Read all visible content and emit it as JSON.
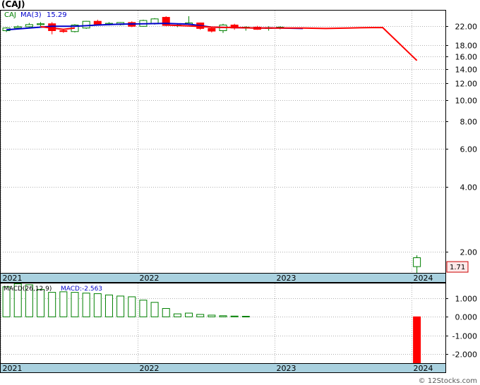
{
  "title": "(CAJ)",
  "footer": "© 12Stocks.com",
  "colors": {
    "up": "#008000",
    "down": "#ff0000",
    "ma": "#0000cc",
    "axis_band": "#a9d1df",
    "grid": "#b0b0b0",
    "macd_label": "#0000cc"
  },
  "chart_data": [
    {
      "type": "candlestick",
      "legend": {
        "symbol": "CAJ",
        "ma_label": "MA(3)",
        "ma_value": "15.29"
      },
      "last_price_label": "1.71",
      "y_scale": "log",
      "ylim": [
        1.6,
        26
      ],
      "y_ticks": [
        2.0,
        4.0,
        6.0,
        8.0,
        10.0,
        12.0,
        14.0,
        16.0,
        18.0,
        22.0
      ],
      "y_tick_labels": [
        "2.00",
        "4.00",
        "6.00",
        "8.00",
        "10.00",
        "12.00",
        "14.00",
        "16.00",
        "18.00",
        "22.00"
      ],
      "x_labels": [
        "2021",
        "2022",
        "2023",
        "2024"
      ],
      "x_label_months": [
        0,
        12,
        24,
        36
      ],
      "xlim": [
        -0.5,
        38.5
      ],
      "candles": [
        {
          "m": 0,
          "o": 21.0,
          "h": 21.8,
          "l": 20.7,
          "c": 21.6
        },
        {
          "m": 1,
          "o": 21.6,
          "h": 22.2,
          "l": 21.3,
          "c": 21.9
        },
        {
          "m": 2,
          "o": 21.9,
          "h": 22.8,
          "l": 21.6,
          "c": 22.4
        },
        {
          "m": 3,
          "o": 22.4,
          "h": 23.0,
          "l": 22.0,
          "c": 22.6
        },
        {
          "m": 4,
          "o": 22.6,
          "h": 23.0,
          "l": 20.2,
          "c": 21.0
        },
        {
          "m": 5,
          "o": 21.0,
          "h": 21.3,
          "l": 20.5,
          "c": 20.8
        },
        {
          "m": 6,
          "o": 20.8,
          "h": 22.5,
          "l": 20.6,
          "c": 22.3
        },
        {
          "m": 7,
          "o": 21.6,
          "h": 23.3,
          "l": 21.4,
          "c": 23.2
        },
        {
          "m": 8,
          "o": 23.2,
          "h": 23.6,
          "l": 22.3,
          "c": 22.5
        },
        {
          "m": 9,
          "o": 22.5,
          "h": 23.0,
          "l": 22.2,
          "c": 22.7
        },
        {
          "m": 10,
          "o": 22.4,
          "h": 23.0,
          "l": 22.2,
          "c": 22.9
        },
        {
          "m": 11,
          "o": 22.9,
          "h": 23.2,
          "l": 21.8,
          "c": 22.0
        },
        {
          "m": 12,
          "o": 22.0,
          "h": 23.6,
          "l": 21.9,
          "c": 23.4
        },
        {
          "m": 13,
          "o": 22.6,
          "h": 24.0,
          "l": 22.4,
          "c": 23.8
        },
        {
          "m": 14,
          "o": 24.2,
          "h": 24.5,
          "l": 22.0,
          "c": 22.2
        },
        {
          "m": 15,
          "o": 22.2,
          "h": 22.6,
          "l": 21.8,
          "c": 22.3
        },
        {
          "m": 16,
          "o": 22.5,
          "h": 24.5,
          "l": 22.3,
          "c": 22.8
        },
        {
          "m": 17,
          "o": 22.8,
          "h": 22.9,
          "l": 21.2,
          "c": 21.5
        },
        {
          "m": 18,
          "o": 21.5,
          "h": 21.9,
          "l": 20.6,
          "c": 20.9
        },
        {
          "m": 19,
          "o": 21.0,
          "h": 22.6,
          "l": 20.5,
          "c": 22.3
        },
        {
          "m": 20,
          "o": 22.3,
          "h": 22.6,
          "l": 21.2,
          "c": 21.6
        },
        {
          "m": 21,
          "o": 21.6,
          "h": 22.0,
          "l": 21.0,
          "c": 21.8
        },
        {
          "m": 22,
          "o": 21.8,
          "h": 22.1,
          "l": 21.2,
          "c": 21.3
        },
        {
          "m": 23,
          "o": 21.5,
          "h": 22.0,
          "l": 21.0,
          "c": 21.7
        },
        {
          "m": 24,
          "o": 21.7,
          "h": 22.0,
          "l": 21.3,
          "c": 21.8
        },
        {
          "m": 36,
          "o": 1.71,
          "h": 1.93,
          "l": 1.6,
          "c": 1.88
        }
      ],
      "ma_blue": [
        {
          "m": 0,
          "v": 21.2
        },
        {
          "m": 2,
          "v": 21.6
        },
        {
          "m": 4,
          "v": 22.0
        },
        {
          "m": 6,
          "v": 22.0
        },
        {
          "m": 8,
          "v": 22.3
        },
        {
          "m": 10,
          "v": 22.5
        },
        {
          "m": 12,
          "v": 22.6
        },
        {
          "m": 14,
          "v": 22.7
        },
        {
          "m": 16,
          "v": 22.5
        },
        {
          "m": 18,
          "v": 21.8
        },
        {
          "m": 20,
          "v": 21.7
        },
        {
          "m": 22,
          "v": 21.6
        },
        {
          "m": 24,
          "v": 21.6
        },
        {
          "m": 26,
          "v": 21.5
        }
      ],
      "ma_red": [
        {
          "m": 3,
          "v": 21.9
        },
        {
          "m": 5,
          "v": 21.3
        },
        {
          "m": 6,
          "v": 21.6
        }
      ],
      "ma_red_tail": [
        {
          "m": 14,
          "v": 22.3
        },
        {
          "m": 16,
          "v": 22.1
        },
        {
          "m": 18,
          "v": 21.8
        },
        {
          "m": 20,
          "v": 21.7
        },
        {
          "m": 22,
          "v": 21.6
        },
        {
          "m": 24,
          "v": 21.6
        },
        {
          "m": 26,
          "v": 21.6
        },
        {
          "m": 28,
          "v": 21.5
        },
        {
          "m": 30,
          "v": 21.6
        },
        {
          "m": 32,
          "v": 21.7
        },
        {
          "m": 33,
          "v": 21.7
        },
        {
          "m": 36,
          "v": 15.29
        }
      ]
    },
    {
      "type": "bar",
      "legend": {
        "label": "MACD(26,12,9)",
        "value_label": "MACD:-2.563"
      },
      "ylim": [
        -2.5,
        1.8
      ],
      "y_ticks": [
        1.0,
        0.0,
        -1.0,
        -2.0
      ],
      "y_tick_labels": [
        "1.000",
        "0.000",
        "-1.000",
        "-2.000"
      ],
      "x_labels": [
        "2021",
        "2022",
        "2023",
        "2024"
      ],
      "bars": [
        {
          "m": 0,
          "v": 1.62
        },
        {
          "m": 1,
          "v": 1.78
        },
        {
          "m": 2,
          "v": 1.73
        },
        {
          "m": 3,
          "v": 1.48
        },
        {
          "m": 4,
          "v": 1.32
        },
        {
          "m": 5,
          "v": 1.35
        },
        {
          "m": 6,
          "v": 1.32
        },
        {
          "m": 7,
          "v": 1.28
        },
        {
          "m": 8,
          "v": 1.25
        },
        {
          "m": 9,
          "v": 1.18
        },
        {
          "m": 10,
          "v": 1.12
        },
        {
          "m": 11,
          "v": 1.08
        },
        {
          "m": 12,
          "v": 0.9
        },
        {
          "m": 13,
          "v": 0.78
        },
        {
          "m": 14,
          "v": 0.45
        },
        {
          "m": 15,
          "v": 0.16
        },
        {
          "m": 16,
          "v": 0.2
        },
        {
          "m": 17,
          "v": 0.13
        },
        {
          "m": 18,
          "v": 0.09
        },
        {
          "m": 19,
          "v": 0.06
        },
        {
          "m": 20,
          "v": 0.04
        },
        {
          "m": 21,
          "v": 0.03
        },
        {
          "m": 36,
          "v": -2.563
        }
      ]
    }
  ]
}
